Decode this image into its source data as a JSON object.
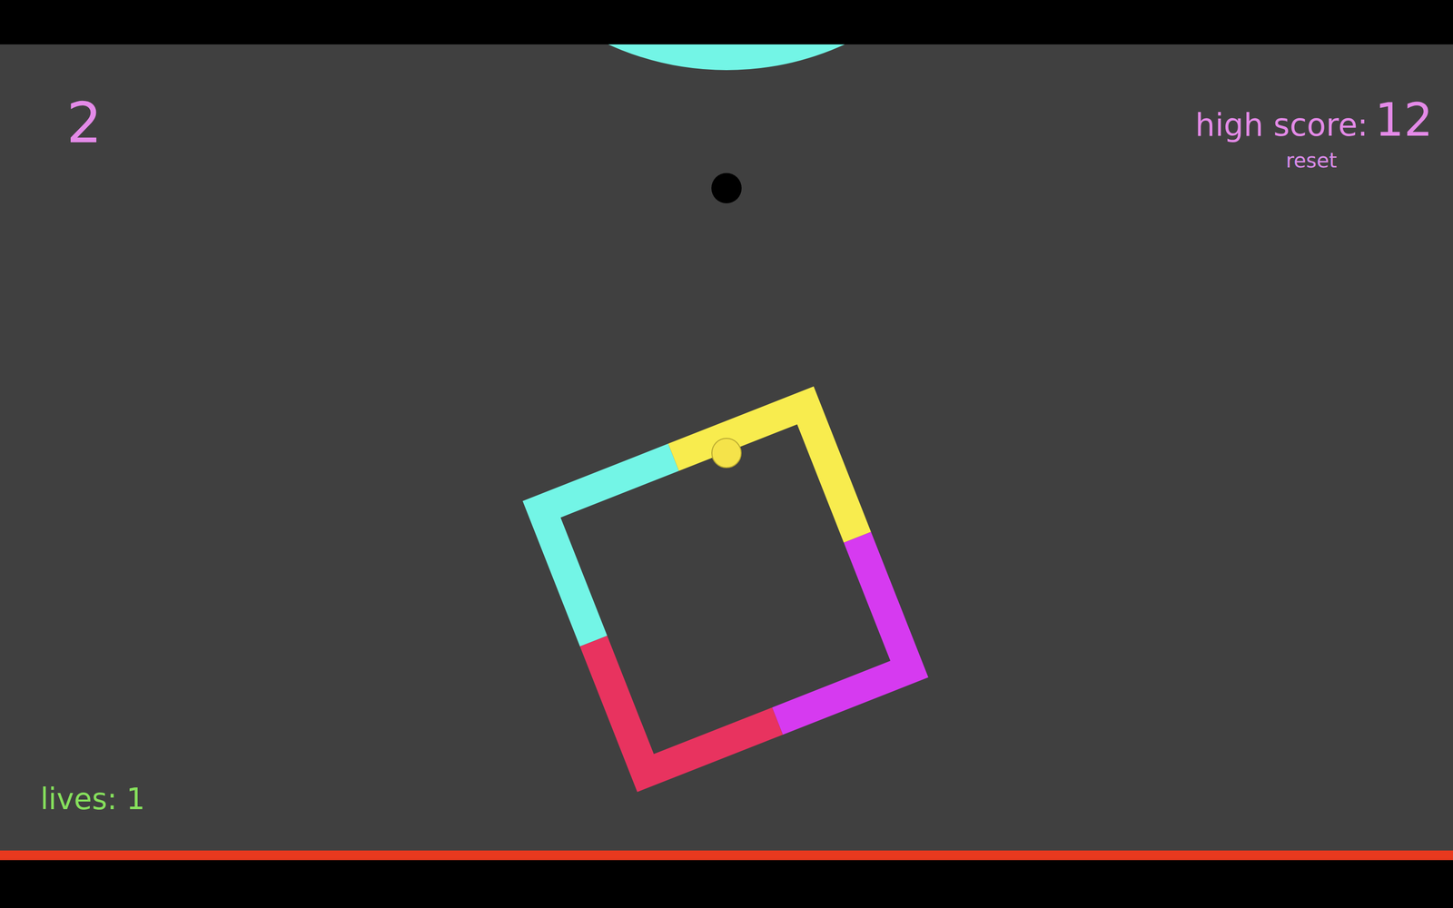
{
  "score": "2",
  "high_score": {
    "label": "high score:",
    "value": "12"
  },
  "reset": "reset",
  "lives": "lives: 1",
  "player": {
    "color": "#f5e34a"
  },
  "obstacle": {
    "segments": [
      {
        "color": "#73f5e6"
      },
      {
        "color": "#f8ec4e"
      },
      {
        "color": "#d63af0"
      },
      {
        "color": "#e8335f"
      }
    ]
  },
  "next_obstacle": {
    "color": "#73f5e6"
  }
}
